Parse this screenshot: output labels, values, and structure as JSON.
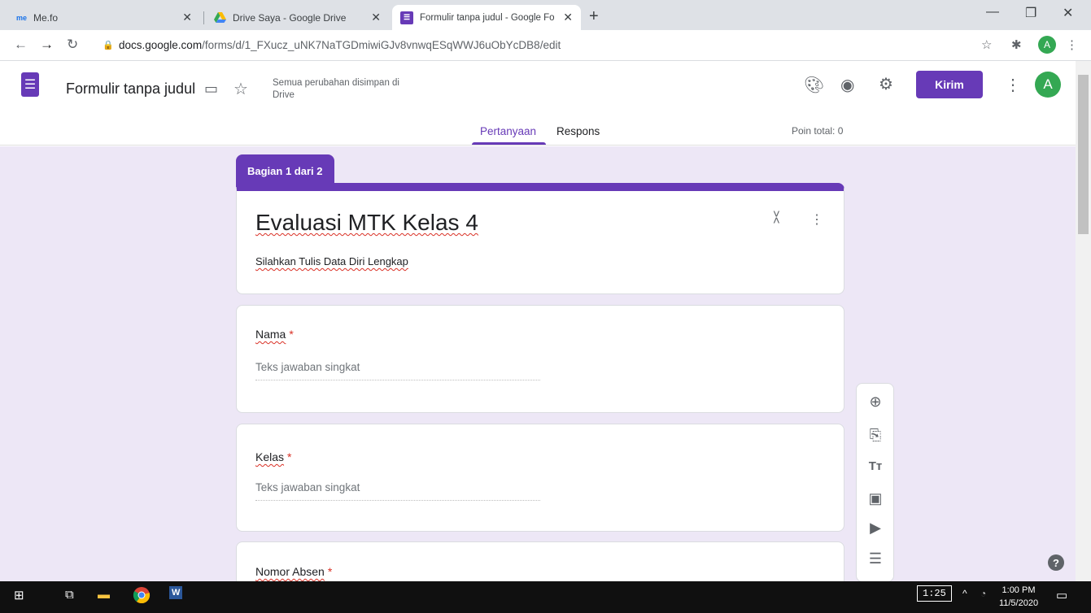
{
  "browser": {
    "tabs": [
      {
        "favicon": "me",
        "title": "Me.fo"
      },
      {
        "favicon": "drive-icon",
        "title": "Drive Saya - Google Drive"
      },
      {
        "favicon": "forms-icon",
        "title": "Formulir tanpa judul - Google Fo"
      }
    ],
    "url_domain": "docs.google.com",
    "url_path": "/forms/d/1_FXucz_uNK7NaTGDmiwiGJv8vnwqESqWWJ6uObYcDB8/edit",
    "profile_initial": "A"
  },
  "header": {
    "title": "Formulir tanpa judul",
    "save_status": "Semua perubahan disimpan di Drive",
    "send_label": "Kirim",
    "avatar_initial": "A",
    "tabs": [
      "Pertanyaan",
      "Respons"
    ],
    "points": "Poin total: 0"
  },
  "form": {
    "section_label": "Bagian 1 dari 2",
    "title": "Evaluasi MTK Kelas 4",
    "description": "Silahkan Tulis Data Diri Lengkap",
    "questions": [
      {
        "label": "Nama",
        "required": "*",
        "placeholder": "Teks jawaban singkat"
      },
      {
        "label": "Kelas",
        "required": "*",
        "placeholder": "Teks jawaban singkat"
      },
      {
        "label": "Nomor Absen",
        "required": "*"
      }
    ]
  },
  "taskbar": {
    "time": "1:00 PM",
    "date": "11/5/2020",
    "battery": "1:25"
  },
  "colors": {
    "accent": "#673ab7",
    "background": "#ede7f6",
    "required": "#d93025"
  }
}
